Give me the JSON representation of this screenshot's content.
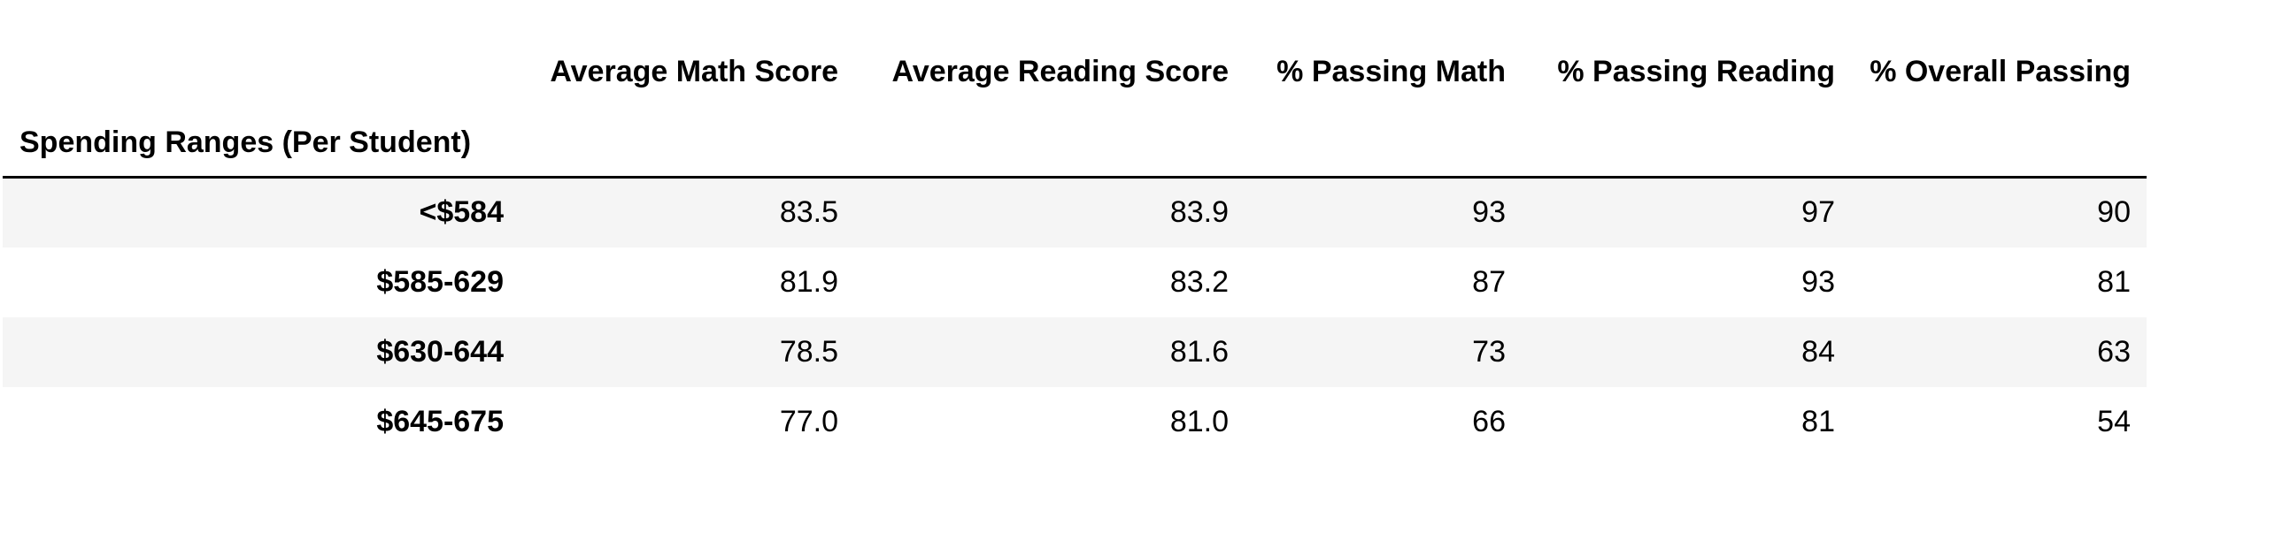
{
  "table": {
    "index_name": "Spending Ranges (Per Student)",
    "columns": [
      "Average Math Score",
      "Average Reading Score",
      "% Passing Math",
      "% Passing Reading",
      "% Overall Passing"
    ],
    "rows": [
      {
        "label": "<$584",
        "cells": [
          "83.5",
          "83.9",
          "93",
          "97",
          "90"
        ]
      },
      {
        "label": "$585-629",
        "cells": [
          "81.9",
          "83.2",
          "87",
          "93",
          "81"
        ]
      },
      {
        "label": "$630-644",
        "cells": [
          "78.5",
          "81.6",
          "73",
          "84",
          "63"
        ]
      },
      {
        "label": "$645-675",
        "cells": [
          "77.0",
          "81.0",
          "66",
          "81",
          "54"
        ]
      }
    ]
  },
  "colors": {
    "stripe": "#f5f5f5",
    "rule": "#000000",
    "text": "#000000"
  }
}
